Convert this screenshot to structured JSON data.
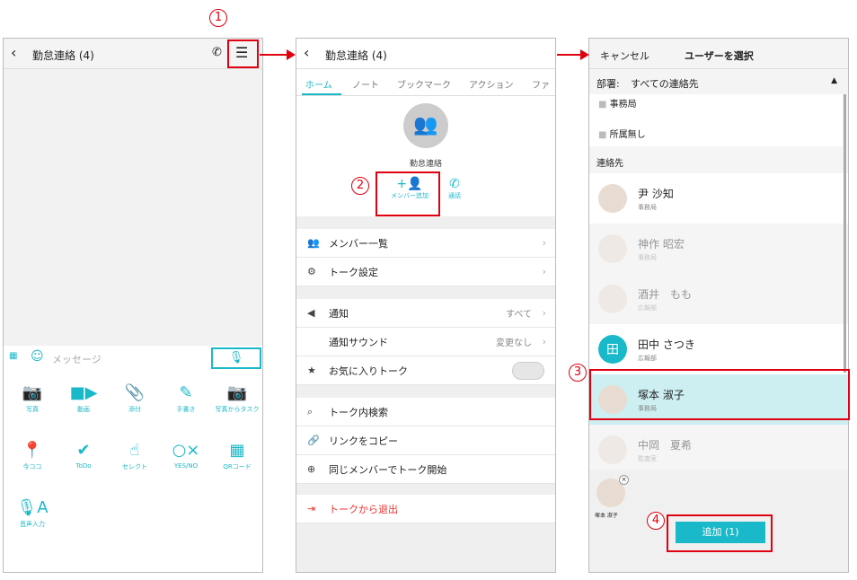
{
  "steps": [
    "1",
    "2",
    "3",
    "4"
  ],
  "chat": {
    "title": "勤怠連絡 (4)",
    "message_placeholder": "メッセージ",
    "tools": [
      {
        "label": "写真",
        "icon": "camera-icon"
      },
      {
        "label": "動画",
        "icon": "video-icon"
      },
      {
        "label": "添付",
        "icon": "paperclip-icon"
      },
      {
        "label": "手書き",
        "icon": "pen-icon"
      },
      {
        "label": "写真からタスク",
        "icon": "camera-task-icon"
      },
      {
        "label": "今ココ",
        "icon": "location-pin-icon"
      },
      {
        "label": "ToDo",
        "icon": "todo-check-icon"
      },
      {
        "label": "セレクト",
        "icon": "select-finger-icon"
      },
      {
        "label": "YES/NO",
        "icon": "yes-no-icon"
      },
      {
        "label": "QRコード",
        "icon": "qr-code-icon"
      },
      {
        "label": "音声入力",
        "icon": "voice-input-icon"
      }
    ]
  },
  "menu": {
    "title": "勤怠連絡 (4)",
    "tabs": [
      "ホーム",
      "ノート",
      "ブックマーク",
      "アクション",
      "ファ"
    ],
    "group_name": "勤怠連絡",
    "add_member": "メンバー追加",
    "call": "通話",
    "rows1": [
      {
        "label": "メンバー一覧"
      },
      {
        "label": "トーク設定"
      }
    ],
    "rows2": [
      {
        "label": "通知",
        "value": "すべて"
      },
      {
        "label": "通知サウンド",
        "value": "変更なし"
      },
      {
        "label": "お気に入りトーク"
      }
    ],
    "rows3": [
      {
        "label": "トーク内検索"
      },
      {
        "label": "リンクをコピー"
      },
      {
        "label": "同じメンバーでトーク開始"
      }
    ],
    "leave": "トークから退出"
  },
  "select": {
    "cancel": "キャンセル",
    "title": "ユーザーを選択",
    "dept_label": "部署:",
    "dept_value": "すべての連絡先",
    "folders": [
      "事務局",
      "所属無し"
    ],
    "section": "連絡先",
    "contacts": [
      {
        "name": "尹 沙知",
        "dept": "事務局"
      },
      {
        "name": "神作 昭宏",
        "dept": "事務局"
      },
      {
        "name": "酒井　もも",
        "dept": "広報部"
      },
      {
        "name": "田中 さつき",
        "dept": "広報部",
        "initial": "田"
      },
      {
        "name": "塚本 淑子",
        "dept": "事務局"
      },
      {
        "name": "中岡　夏希",
        "dept": "監査室"
      }
    ],
    "selected_name": "塚本 淑子",
    "add_button": "追加 (1)"
  },
  "colors": {
    "accent": "#1ab9c9",
    "highlight": "#e00010"
  }
}
